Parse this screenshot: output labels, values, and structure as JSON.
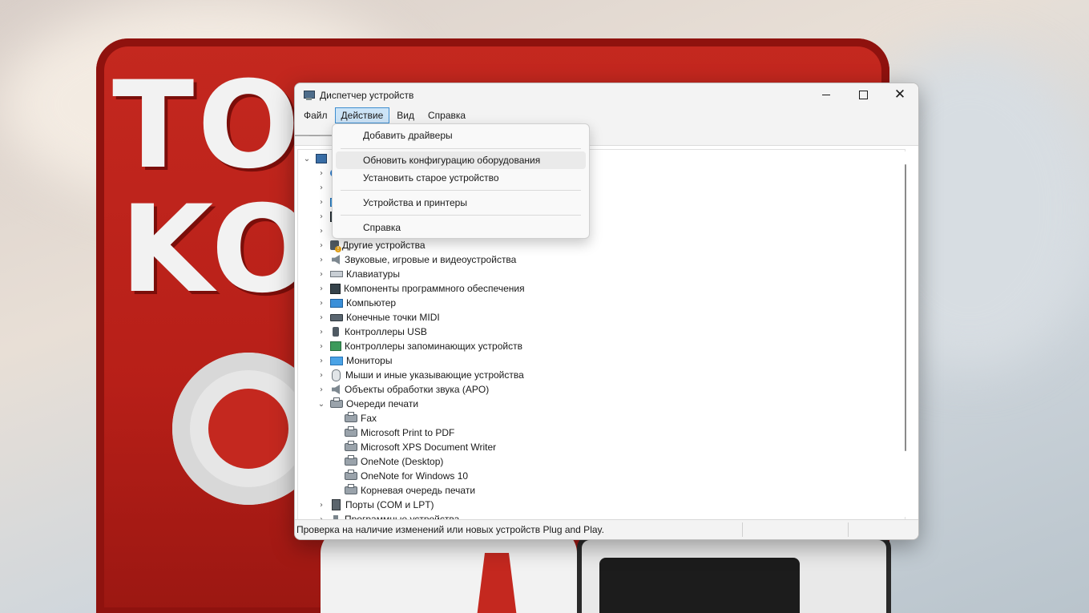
{
  "window": {
    "title": "Диспетчер устройств",
    "controls": {
      "minimize": "—",
      "maximize": "□",
      "close": "✕"
    }
  },
  "menubar": {
    "items": [
      "Файл",
      "Действие",
      "Вид",
      "Справка"
    ],
    "active_index": 1
  },
  "toolbar": {
    "back": "🡐",
    "forward": "🡒"
  },
  "action_menu": {
    "items": [
      "Добавить драйверы",
      "Обновить конфигурацию оборудования",
      "Установить старое устройство",
      "Устройства и принтеры",
      "Справка"
    ],
    "hovered_index": 1
  },
  "tree": {
    "categories": [
      "Другие устройства",
      "Звуковые, игровые и видеоустройства",
      "Клавиатуры",
      "Компоненты программного обеспечения",
      "Компьютер",
      "Конечные точки MIDI",
      "Контроллеры USB",
      "Контроллеры запоминающих устройств",
      "Мониторы",
      "Мыши и иные указывающие устройства",
      "Объекты обработки звука (APO)",
      "Очереди печати"
    ],
    "print_queues": [
      "Fax",
      "Microsoft Print to PDF",
      "Microsoft XPS Document Writer",
      "OneNote (Desktop)",
      "OneNote for Windows 10",
      "Корневая очередь печати"
    ],
    "after": [
      "Порты (COM и LPT)",
      "Программные устройства"
    ]
  },
  "status": {
    "text": "Проверка на наличие изменений или новых устройств Plug and Play."
  },
  "icons": {
    "expand": "›",
    "collapse": "⌄"
  }
}
